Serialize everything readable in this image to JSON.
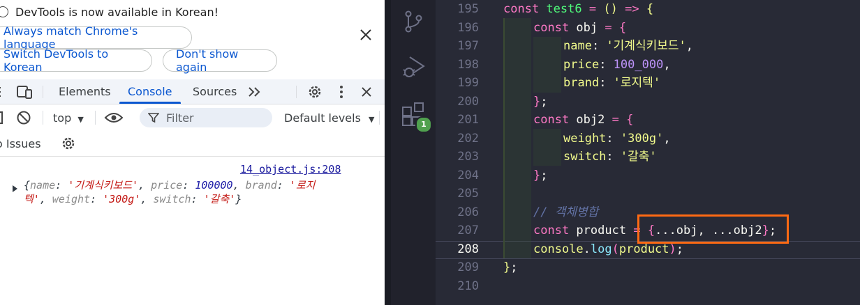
{
  "devtools": {
    "infobar": {
      "message": "DevTools is now available in Korean!",
      "always_match_label": "Always match Chrome's language",
      "switch_label": "Switch DevTools to Korean",
      "dont_show_label": "Don't show again"
    },
    "tabs": {
      "elements": "Elements",
      "console": "Console",
      "sources": "Sources"
    },
    "console_toolbar": {
      "context": "top",
      "filter_placeholder": "Filter",
      "levels": "Default levels",
      "issues": "o Issues"
    },
    "console_output": {
      "source_link": "14_object.js:208",
      "log_line_1": [
        "{",
        "name",
        ": ",
        "'기계식키보드'",
        ", ",
        "price",
        ": ",
        "100000",
        ", ",
        "brand",
        ": ",
        "'로지"
      ],
      "log_line_2": [
        "텍'",
        ", ",
        "weight",
        ": ",
        "'300g'",
        ", ",
        "switch",
        ": ",
        "'갈축'",
        "}"
      ]
    }
  },
  "editor": {
    "activity_badge": "1",
    "line_numbers": [
      "195",
      "196",
      "197",
      "198",
      "199",
      "200",
      "201",
      "202",
      "203",
      "204",
      "205",
      "206",
      "207",
      "208",
      "209",
      "210"
    ],
    "active_line": "208",
    "code": {
      "l195": [
        "const",
        " ",
        "test6",
        " ",
        "=",
        " ",
        "()",
        " ",
        "=>",
        " ",
        "{"
      ],
      "l196": [
        "const",
        " obj ",
        "=",
        " ",
        "{"
      ],
      "l197": [
        "name",
        ": ",
        "'기계식키보드'",
        ","
      ],
      "l198": [
        "price",
        ": ",
        "100_000",
        ","
      ],
      "l199": [
        "brand",
        ": ",
        "'로지텍'"
      ],
      "l200": [
        "}",
        ";"
      ],
      "l201": [
        "const",
        " obj2 ",
        "=",
        " ",
        "{"
      ],
      "l202": [
        "weight",
        ": ",
        "'300g'",
        ","
      ],
      "l203": [
        "switch",
        ": ",
        "'갈축'"
      ],
      "l204": [
        "}",
        ";"
      ],
      "l206": [
        "// 객체병합"
      ],
      "l207": [
        "const",
        " product ",
        "=",
        " ",
        "{",
        "...obj, ...obj2",
        "}",
        ";"
      ],
      "l208": [
        "console",
        ".",
        "log",
        "(",
        "product",
        ")",
        ";"
      ],
      "l209": [
        "}",
        ";"
      ]
    }
  }
}
